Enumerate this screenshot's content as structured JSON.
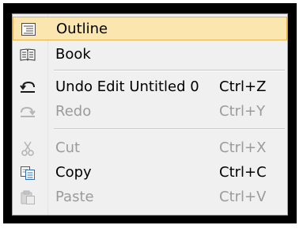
{
  "menu": {
    "items": [
      {
        "label": "Outline",
        "shortcut": "",
        "icon": "outline-icon",
        "state": "highlighted"
      },
      {
        "label": "Book",
        "shortcut": "",
        "icon": "book-icon",
        "state": "enabled"
      },
      {
        "label": "Undo  Edit Untitled 0",
        "shortcut": "Ctrl+Z",
        "icon": "undo-icon",
        "state": "enabled"
      },
      {
        "label": "Redo",
        "shortcut": "Ctrl+Y",
        "icon": "redo-icon",
        "state": "disabled"
      },
      {
        "label": "Cut",
        "shortcut": "Ctrl+X",
        "icon": "scissors-icon",
        "state": "disabled"
      },
      {
        "label": "Copy",
        "shortcut": "Ctrl+C",
        "icon": "copy-icon",
        "state": "enabled"
      },
      {
        "label": "Paste",
        "shortcut": "Ctrl+V",
        "icon": "paste-icon",
        "state": "disabled"
      }
    ]
  },
  "colors": {
    "highlight_fill": "#fbe6b0",
    "highlight_border": "#e6b450",
    "disabled_text": "#9b9b9b",
    "menu_background": "#f0f0f0",
    "frame": "#000000"
  }
}
